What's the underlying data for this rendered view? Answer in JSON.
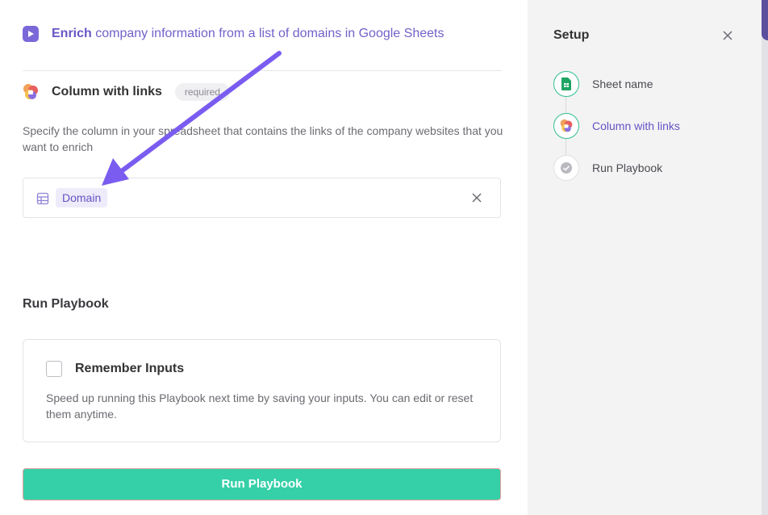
{
  "header": {
    "title_bold": "Enrich",
    "title_rest": " company information from a list of domains in Google Sheets"
  },
  "section": {
    "title": "Column with links",
    "badge": "required",
    "description": "Specify the column in your spreadsheet that contains the links of the company websites that you want to enrich"
  },
  "column_input": {
    "selected_value": "Domain"
  },
  "run": {
    "heading": "Run Playbook",
    "remember_label": "Remember Inputs",
    "remember_checked": false,
    "remember_description": "Speed up running this Playbook next time by saving your inputs. You can edit or reset them anytime.",
    "button_label": "Run Playbook"
  },
  "setup": {
    "title": "Setup",
    "steps": [
      {
        "label": "Sheet name",
        "status": "done",
        "icon": "google-sheets-icon"
      },
      {
        "label": "Column with links",
        "status": "active",
        "icon": "clay-logo-icon"
      },
      {
        "label": "Run Playbook",
        "status": "pending",
        "icon": "check-circle-icon"
      }
    ]
  },
  "colors": {
    "accent": "#6553c4",
    "run_button": "#35d0a8",
    "step_done_border": "#2fbf8f",
    "annotation_arrow": "#7a5cf0"
  }
}
